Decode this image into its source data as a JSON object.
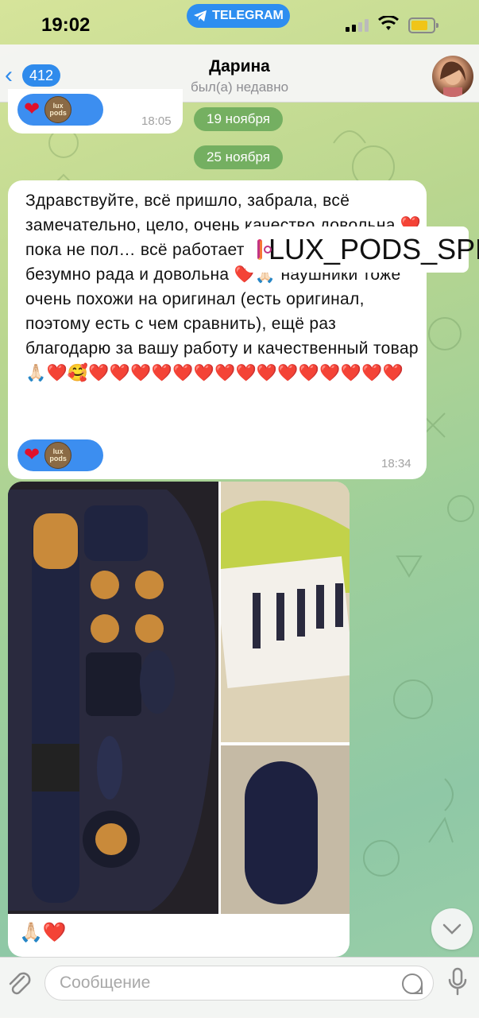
{
  "status_bar": {
    "time": "19:02",
    "app_pill": "TELEGRAM"
  },
  "header": {
    "back_count": "412",
    "contact_name": "Дарина",
    "contact_status": "был(а) недавно"
  },
  "messages": [
    {
      "type": "reaction_only",
      "time": "18:05",
      "reactions": [
        "heart",
        "lux-pods-avatar"
      ]
    },
    {
      "type": "text",
      "text": "Здравствуйте, всё пришло, забрала, всё замечательно, цело, очень качество довольна ❤️ пока не пол…        всё работает в высшем классе, безумно рада и довольна ❤️🙏🏻 наушники тоже очень похожи на оригинал (есть оригинал, поэтому есть с чем сравнить), ещё раз благодарю за вашу работу и качественный товар 🙏🏻❤️🥰❤️❤️❤️❤️❤️❤️❤️❤️❤️❤️❤️❤️❤️❤️❤️",
      "time": "18:34",
      "reactions": [
        "heart",
        "lux-pods-avatar"
      ]
    },
    {
      "type": "photo_album",
      "caption": "🙏🏻❤️"
    }
  ],
  "date_separators": [
    "19 ноября",
    "25 ноября"
  ],
  "watermark": "LUX_PODS_SPB",
  "lux_avatar_text": "lux pods",
  "input": {
    "placeholder": "Сообщение"
  },
  "colors": {
    "accent": "#2f8bec",
    "reaction_pill": "#3c8ef0",
    "heart": "#e0102a",
    "date_pill": "#5aa050"
  }
}
